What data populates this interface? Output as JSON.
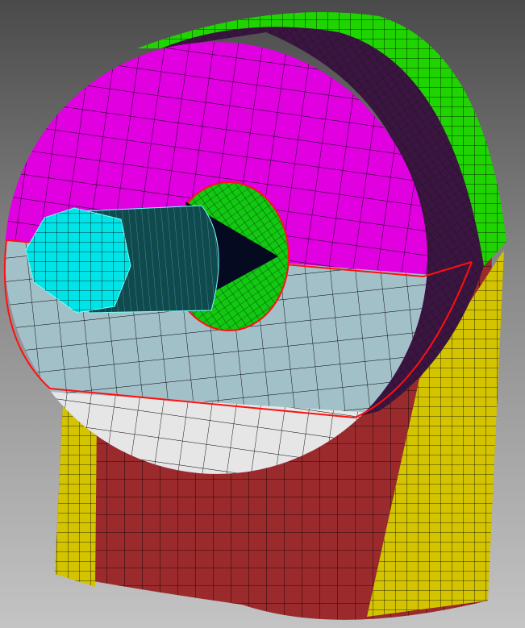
{
  "viewport": {
    "background_top": "#4a4a4a",
    "background_bottom": "#c4c4c4"
  },
  "mesh_parts": [
    {
      "id": "pipe-body",
      "color": "#9b2a2c",
      "label": ""
    },
    {
      "id": "pipe-side-band",
      "color": "#d4c400",
      "label": ""
    },
    {
      "id": "disk-rim-top",
      "color": "#1fd400",
      "label": ""
    },
    {
      "id": "disk-side-shadow",
      "color": "#3a1540",
      "label": ""
    },
    {
      "id": "disk-face-upper",
      "color": "#e000e0",
      "label": ""
    },
    {
      "id": "disk-face-middle",
      "color": "#a2c0c8",
      "label": ""
    },
    {
      "id": "disk-face-lower",
      "color": "#e6e6e6",
      "label": ""
    },
    {
      "id": "hub-ring",
      "color": "#12c812",
      "label": ""
    },
    {
      "id": "shaft-barrel",
      "color": "#0f4a4c",
      "label": ""
    },
    {
      "id": "shaft-end-cap",
      "color": "#00e4e8",
      "label": ""
    },
    {
      "id": "seam-line",
      "color": "#ff1010",
      "label": ""
    }
  ]
}
